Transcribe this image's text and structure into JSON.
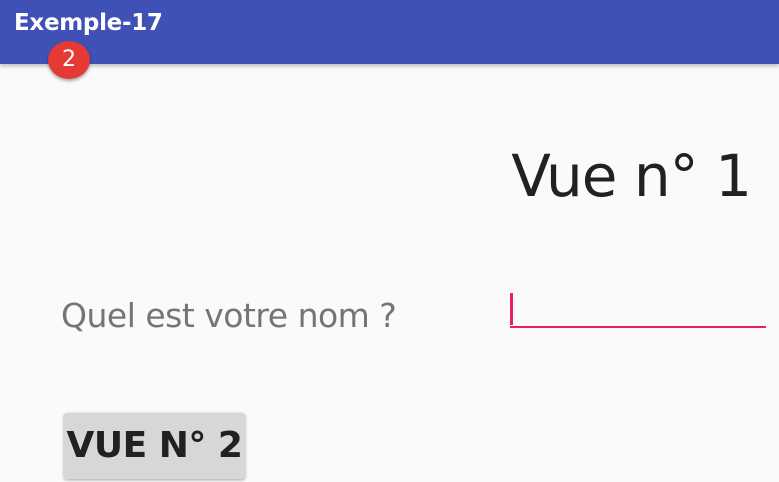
{
  "toolbar": {
    "title": "Exemple-17",
    "badge_count": "2",
    "colors": {
      "background": "#3f51b5",
      "badge": "#e53935"
    }
  },
  "main": {
    "view_title": "Vue n° 1",
    "name_prompt": "Quel est votre nom ?",
    "name_input": {
      "value": "",
      "placeholder": "",
      "accent_color": "#e91e63"
    },
    "next_view_button": "VUE N° 2"
  }
}
